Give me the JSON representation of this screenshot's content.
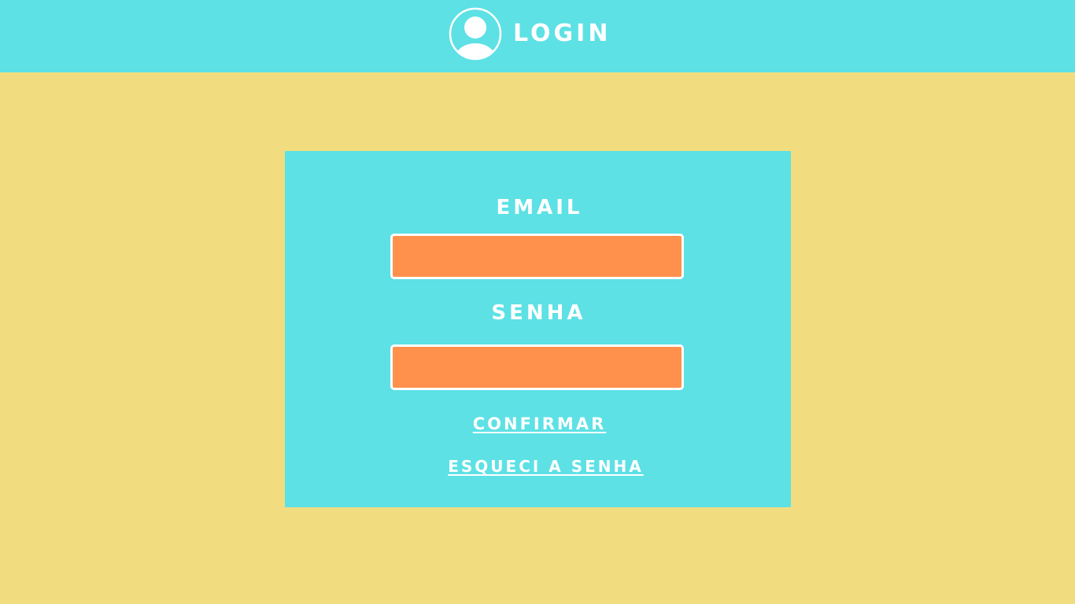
{
  "header": {
    "title": "LOGIN",
    "icon": "user-avatar-icon",
    "background_color": "#5DE1E5"
  },
  "page": {
    "background_color": "#F1DD80"
  },
  "form": {
    "background_color": "#5DE1E5",
    "email": {
      "label": "EMAIL",
      "value": "",
      "placeholder": ""
    },
    "senha": {
      "label": "SENHA",
      "value": "",
      "placeholder": ""
    },
    "field_color": "#FF914D",
    "confirm_label": "CONFIRMAR",
    "forgot_label": "ESQUECI A SENHA"
  }
}
